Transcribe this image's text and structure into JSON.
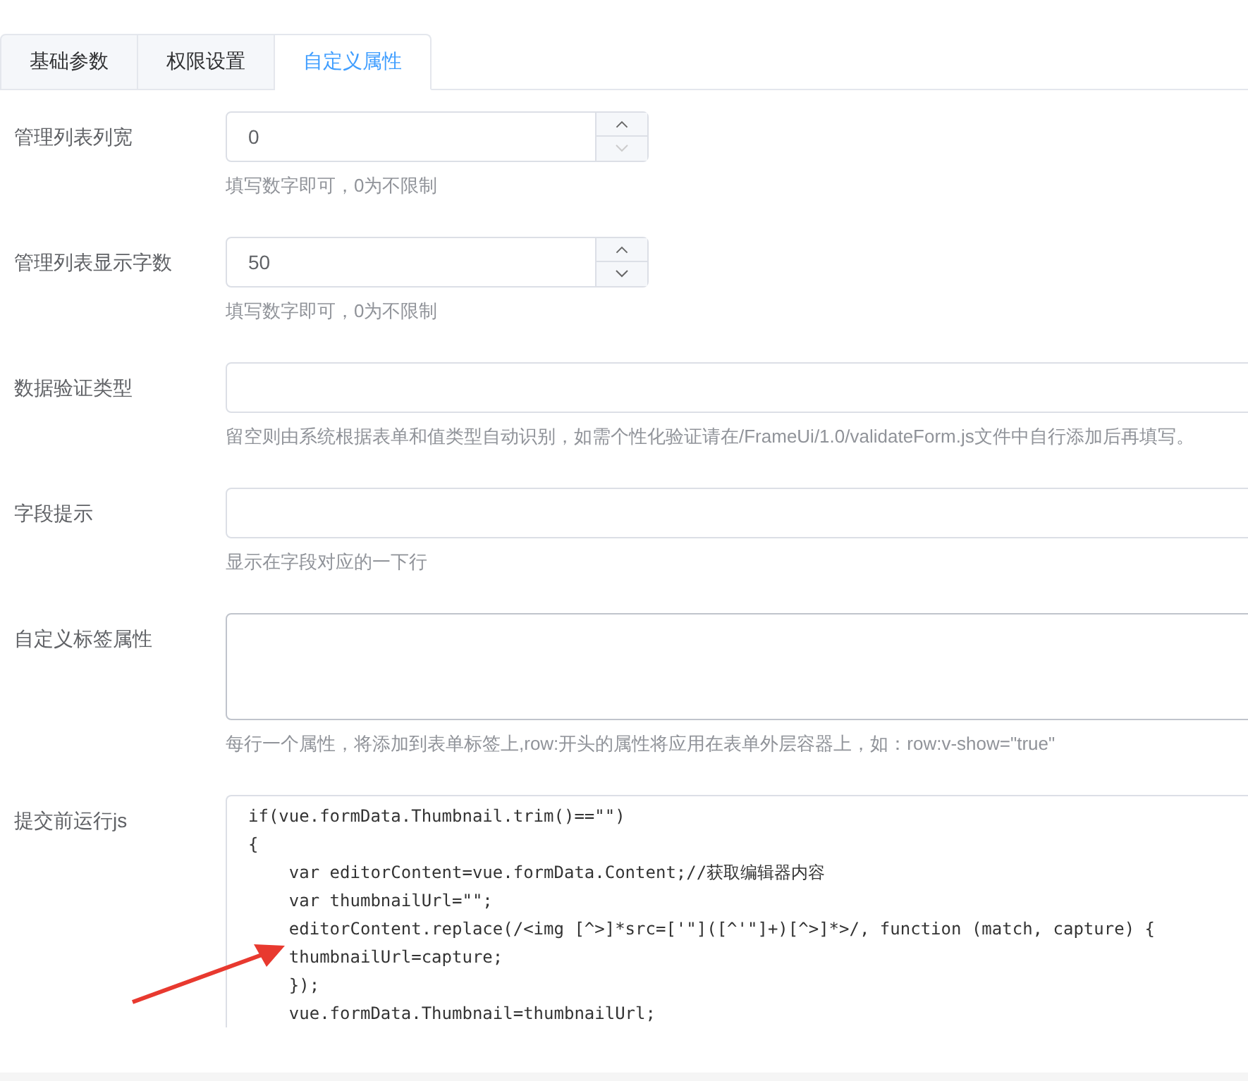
{
  "tabs": [
    {
      "label": "基础参数",
      "selected": false
    },
    {
      "label": "权限设置",
      "selected": false
    },
    {
      "label": "自定义属性",
      "selected": true
    }
  ],
  "fields": [
    {
      "kind": "number",
      "label": "管理列表列宽",
      "value": "0",
      "hint": "填写数字即可，0为不限制"
    },
    {
      "kind": "number",
      "label": "管理列表显示字数",
      "value": "50",
      "hint": "填写数字即可，0为不限制"
    },
    {
      "kind": "text",
      "label": "数据验证类型",
      "hint": "留空则由系统根据表单和值类型自动识别，如需个性化验证请在/FrameUi/1.0/validateForm.js文件中自行添加后再填写。"
    },
    {
      "kind": "text",
      "label": "字段提示",
      "hint": "显示在字段对应的一下行"
    },
    {
      "kind": "textarea",
      "label": "自定义标签属性",
      "hint": "每行一个属性，将添加到表单标签上,row:开头的属性将应用在表单外层容器上，如：row:v-show=\"true\""
    },
    {
      "kind": "code",
      "label": "提交前运行js",
      "lines": [
        "if(vue.formData.Thumbnail.trim()==\"\")",
        "{",
        "    var editorContent=vue.formData.Content;//获取编辑器内容",
        "    var thumbnailUrl=\"\";",
        "    editorContent.replace(/<img [^>]*src=['\"]([^'\"]+)[^>]*>/, function (match, capture) {",
        "    thumbnailUrl=capture;",
        "    });",
        "    vue.formData.Thumbnail=thumbnailUrl;"
      ]
    }
  ]
}
